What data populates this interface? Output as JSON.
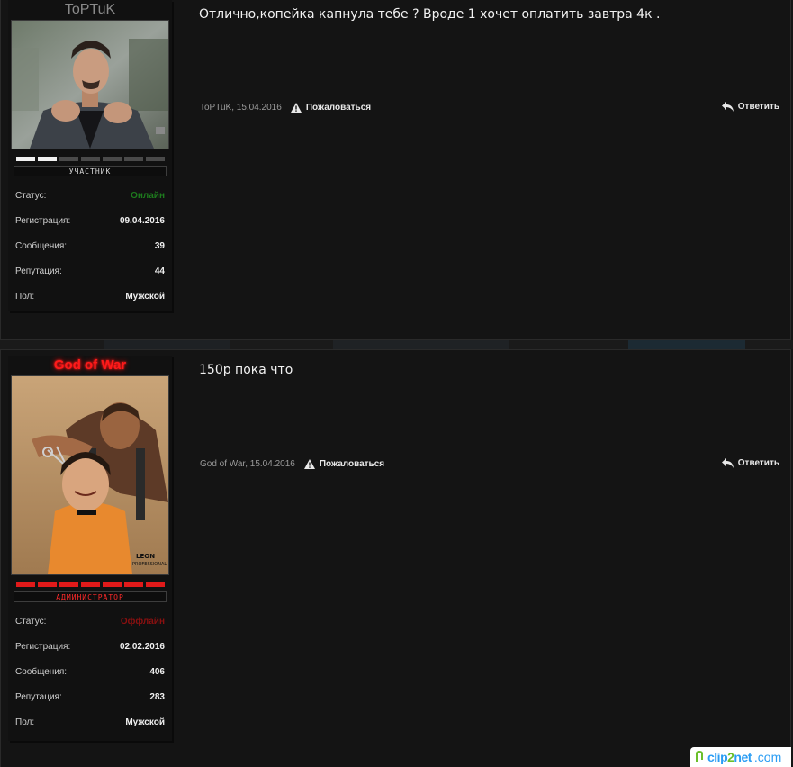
{
  "posts": [
    {
      "username": "ToPTuK",
      "rank": "УЧАСТНИК",
      "rank_level": 2,
      "rank_total": 7,
      "stats": [
        {
          "label": "Статус:",
          "value": "Онлайн"
        },
        {
          "label": "Регистрация:",
          "value": "09.04.2016"
        },
        {
          "label": "Сообщения:",
          "value": "39"
        },
        {
          "label": "Репутация:",
          "value": "44"
        },
        {
          "label": "Пол:",
          "value": "Мужской"
        }
      ],
      "message": "Отлично,копейка капнула тебе ? Вроде 1 хочет оплатить завтра 4к .",
      "meta": "ToPTuK, 15.04.2016",
      "report_label": "Пожаловаться",
      "reply_label": "Ответить"
    },
    {
      "username": "God of War",
      "rank": "АДМИНИСТРАТОР",
      "rank_level": 7,
      "rank_total": 7,
      "avatar_text": "LEON THE PROFESSIONAL",
      "stats": [
        {
          "label": "Статус:",
          "value": "Оффлайн"
        },
        {
          "label": "Регистрация:",
          "value": "02.02.2016"
        },
        {
          "label": "Сообщения:",
          "value": "406"
        },
        {
          "label": "Репутация:",
          "value": "283"
        },
        {
          "label": "Пол:",
          "value": "Мужской"
        }
      ],
      "message": "150р пока что",
      "meta": "God of War, 15.04.2016",
      "report_label": "Пожаловаться",
      "reply_label": "Ответить"
    }
  ],
  "watermark": {
    "brand_a": "clip",
    "brand_b": "2",
    "brand_c": "net",
    "tld": ".com"
  },
  "colors": {
    "online": "#1d7a1d",
    "offline": "#8a1010",
    "admin_name": "#ff1a1a",
    "member_name": "#8a8a8a",
    "background": "#141414"
  }
}
